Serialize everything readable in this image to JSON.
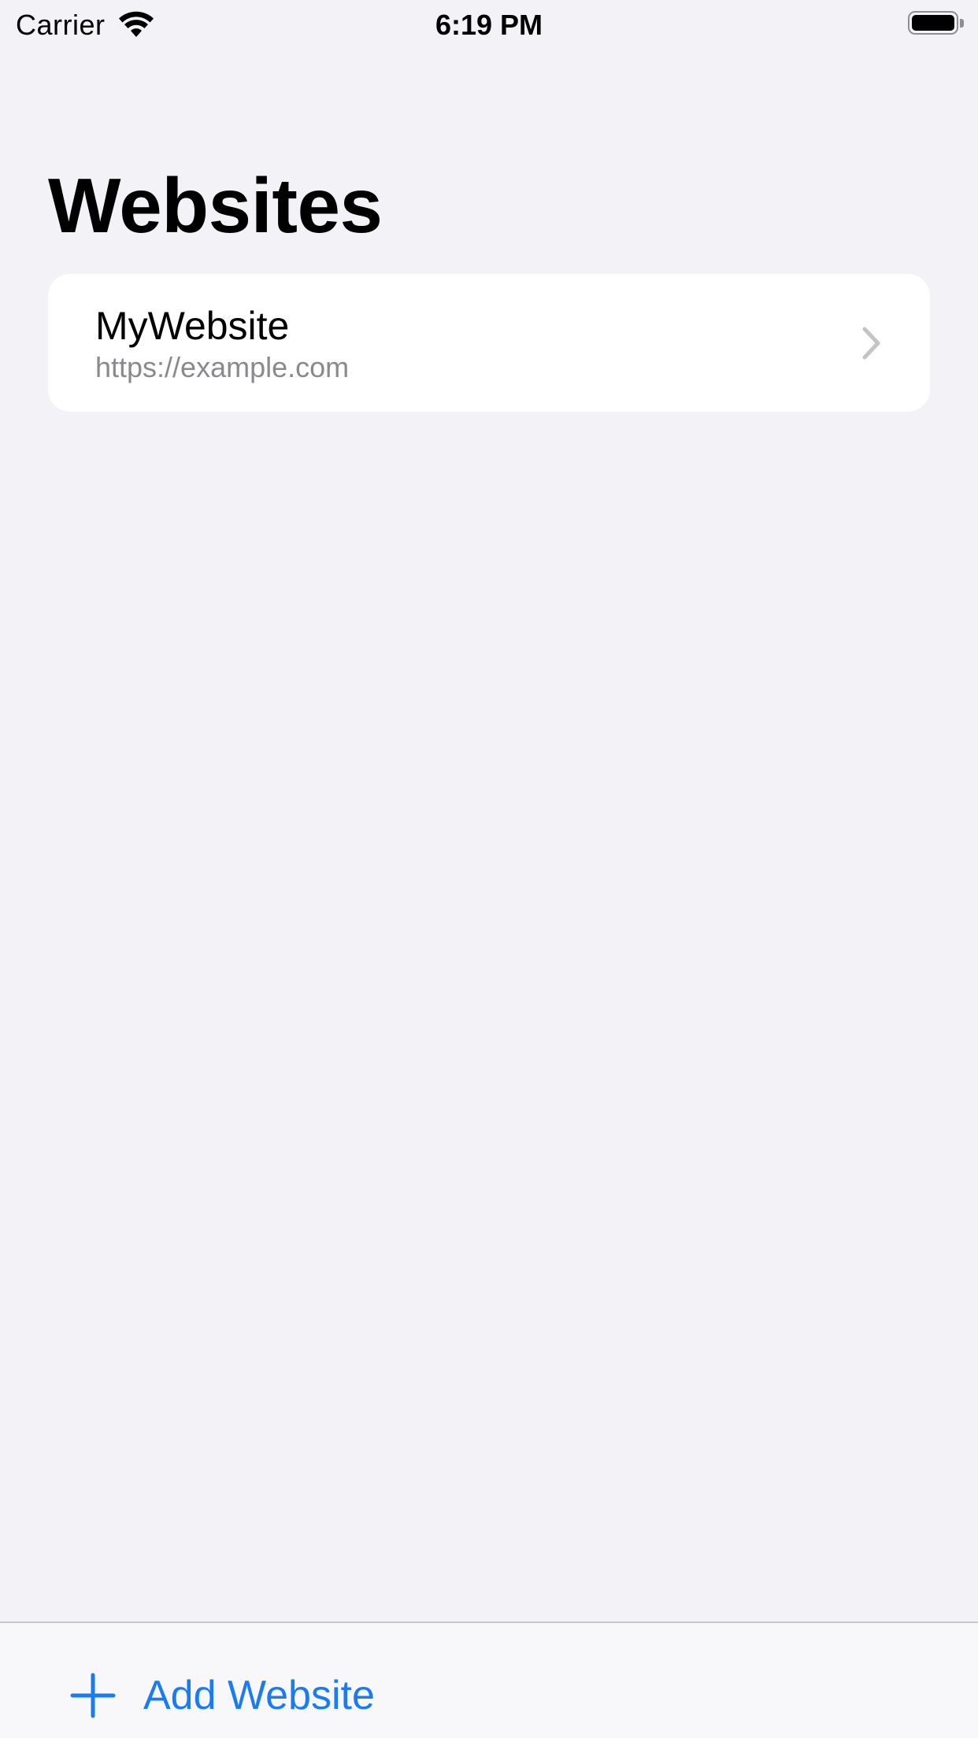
{
  "status_bar": {
    "carrier": "Carrier",
    "time": "6:19 PM",
    "icons": [
      "wifi-icon",
      "battery-icon"
    ]
  },
  "header": {
    "title": "Websites"
  },
  "list": {
    "items": [
      {
        "title": "MyWebsite",
        "subtitle": "https://example.com",
        "accessory": "chevron-right-icon"
      }
    ]
  },
  "toolbar": {
    "add_label": "Add Website",
    "add_icon": "plus-icon"
  },
  "colors": {
    "background": "#f2f2f7",
    "card": "#ffffff",
    "accent": "#1a7cf0",
    "secondary_text": "#8a8a8e",
    "chevron": "#c4c4c7"
  }
}
